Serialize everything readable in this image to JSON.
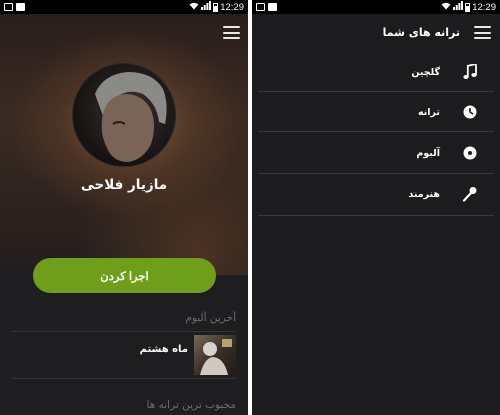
{
  "status_bar": {
    "time": "12:29"
  },
  "left_screen": {
    "artist_name": "مازیار فلاحی",
    "play_label": "اجرا کردن",
    "latest_album_title": "آخرین آلبوم",
    "album": {
      "name": "ماه هشتم"
    },
    "popular_tracks_title": "محبوب ترین ترانه ها"
  },
  "right_screen": {
    "drawer_title": "ترانه های شما",
    "menu": [
      {
        "label": "گلچین",
        "icon": "music-note-icon"
      },
      {
        "label": "ترانه",
        "icon": "clock-icon"
      },
      {
        "label": "آلبوم",
        "icon": "disc-icon"
      },
      {
        "label": "هنرمند",
        "icon": "microphone-icon"
      }
    ]
  },
  "colors": {
    "accent_green": "#6f9f1a",
    "background": "#1e1e21",
    "divider": "#34343a",
    "secondary_text": "#6d6d70"
  }
}
